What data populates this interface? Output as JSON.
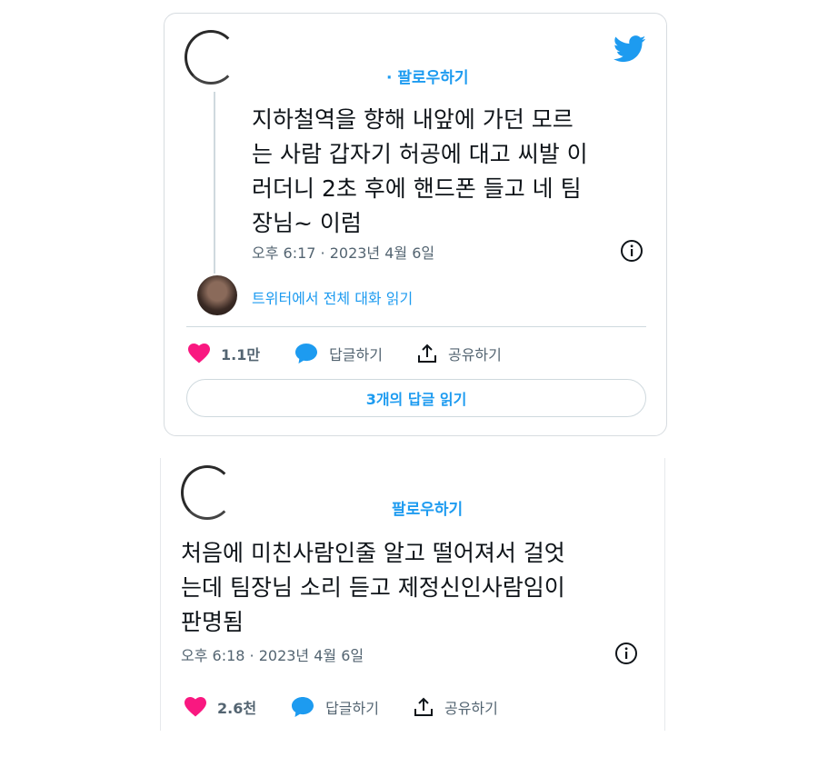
{
  "tweets": [
    {
      "follow_label": "· 팔로우하기",
      "text": "지하철역을 향해 내앞에 가던 모르\n는 사람 갑자기 허공에 대고 씨발 이\n러더니 2초 후에 핸드폰 들고 네 팀\n장님~ 이럼",
      "timestamp": "오후 6:17 · 2023년 4월 6일",
      "read_thread": "트위터에서 전체 대화 읽기",
      "likes": "1.1만",
      "reply_label": "답글하기",
      "share_label": "공유하기",
      "read_replies": "3개의 답글 읽기"
    },
    {
      "follow_label": "팔로우하기",
      "text": "처음에 미친사람인줄 알고 떨어져서 걸엇\n는데 팀장님 소리 듣고 제정신인사람임이\n판명됨",
      "timestamp": "오후 6:18 · 2023년 4월 6일",
      "likes": "2.6천",
      "reply_label": "답글하기",
      "share_label": "공유하기"
    }
  ],
  "icons": {
    "brand": "twitter-bird",
    "like": "heart",
    "reply": "speech-bubble",
    "share": "share-arrow",
    "info": "info-circle"
  },
  "colors": {
    "accent": "#1d9bf0",
    "like": "#f91880",
    "muted": "#536471"
  }
}
